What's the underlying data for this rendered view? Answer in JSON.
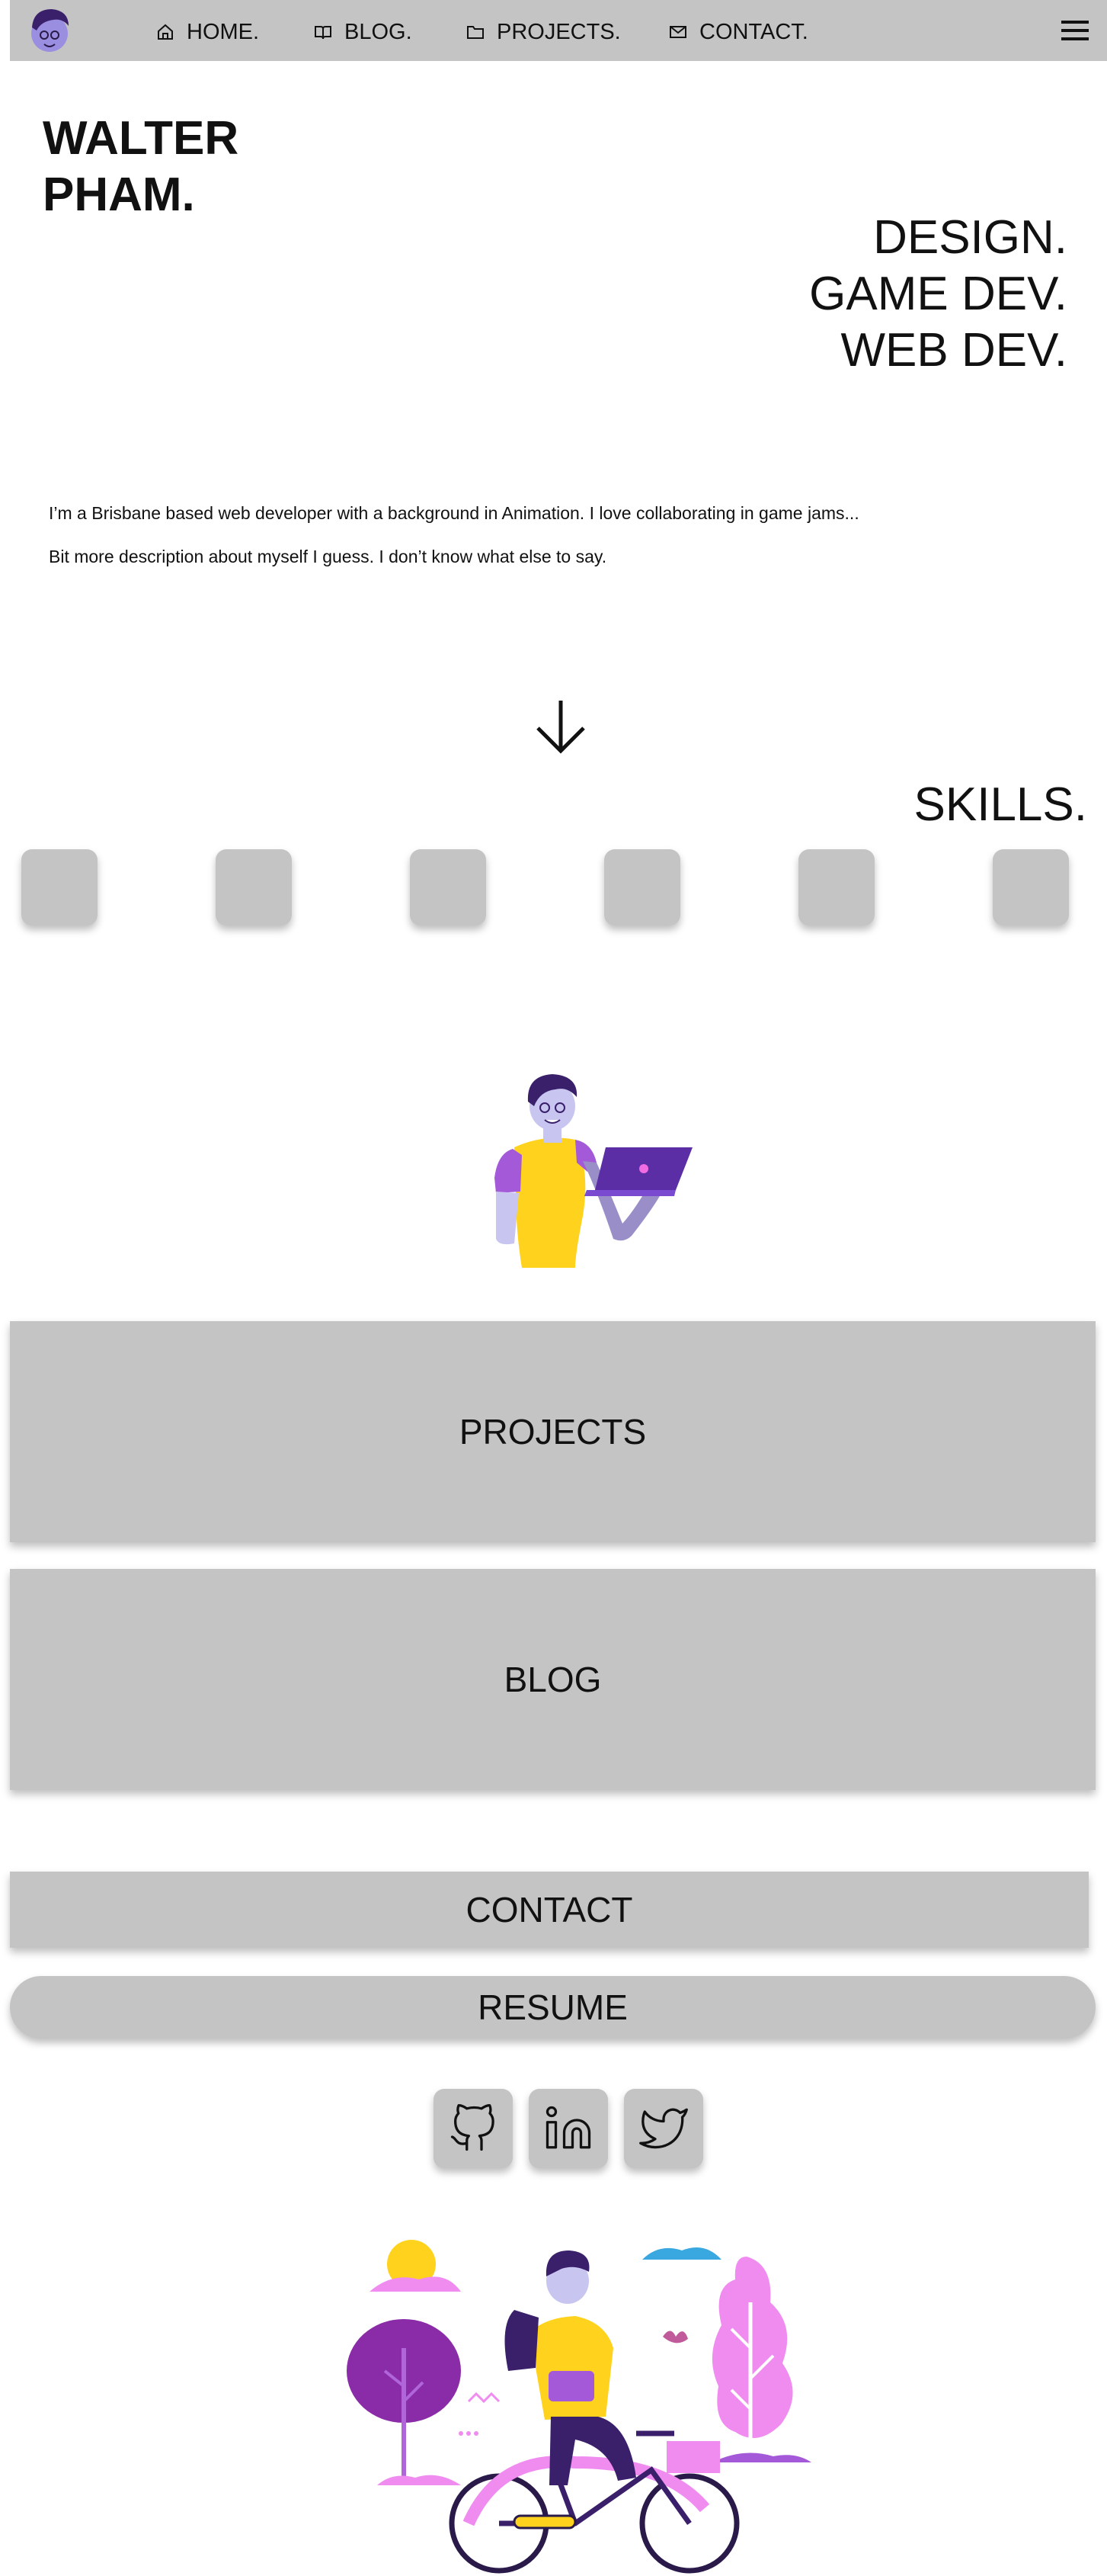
{
  "nav": {
    "items": [
      {
        "label": "HOME.",
        "icon": "home-icon"
      },
      {
        "label": "BLOG.",
        "icon": "book-icon"
      },
      {
        "label": "PROJECTS.",
        "icon": "folder-icon"
      },
      {
        "label": "CONTACT.",
        "icon": "mail-icon"
      }
    ],
    "menu_icon": "hamburger-menu-icon",
    "logo_icon": "avatar-logo"
  },
  "hero": {
    "name_line1": "WALTER",
    "name_line2": "PHAM.",
    "tagline": [
      "DESIGN.",
      "GAME DEV.",
      "WEB DEV."
    ]
  },
  "intro": {
    "line1": "I’m a Brisbane based web developer with a background in Animation. I love collaborating in game jams...",
    "line2": "Bit more description about myself I guess. I don’t know what else to say."
  },
  "skills": {
    "title": "SKILLS.",
    "count": 6
  },
  "sections": {
    "projects_label": "PROJECTS",
    "blog_label": "BLOG"
  },
  "buttons": {
    "contact_label": "CONTACT",
    "resume_label": "RESUME"
  },
  "social": [
    "github-icon",
    "linkedin-icon",
    "twitter-icon"
  ],
  "colors": {
    "nav_bg": "#c4c4c4",
    "card_bg": "#c4c4c4",
    "accent_purple": "#8e3cc8",
    "accent_yellow": "#ffd21e",
    "accent_pink": "#f08cf0"
  }
}
